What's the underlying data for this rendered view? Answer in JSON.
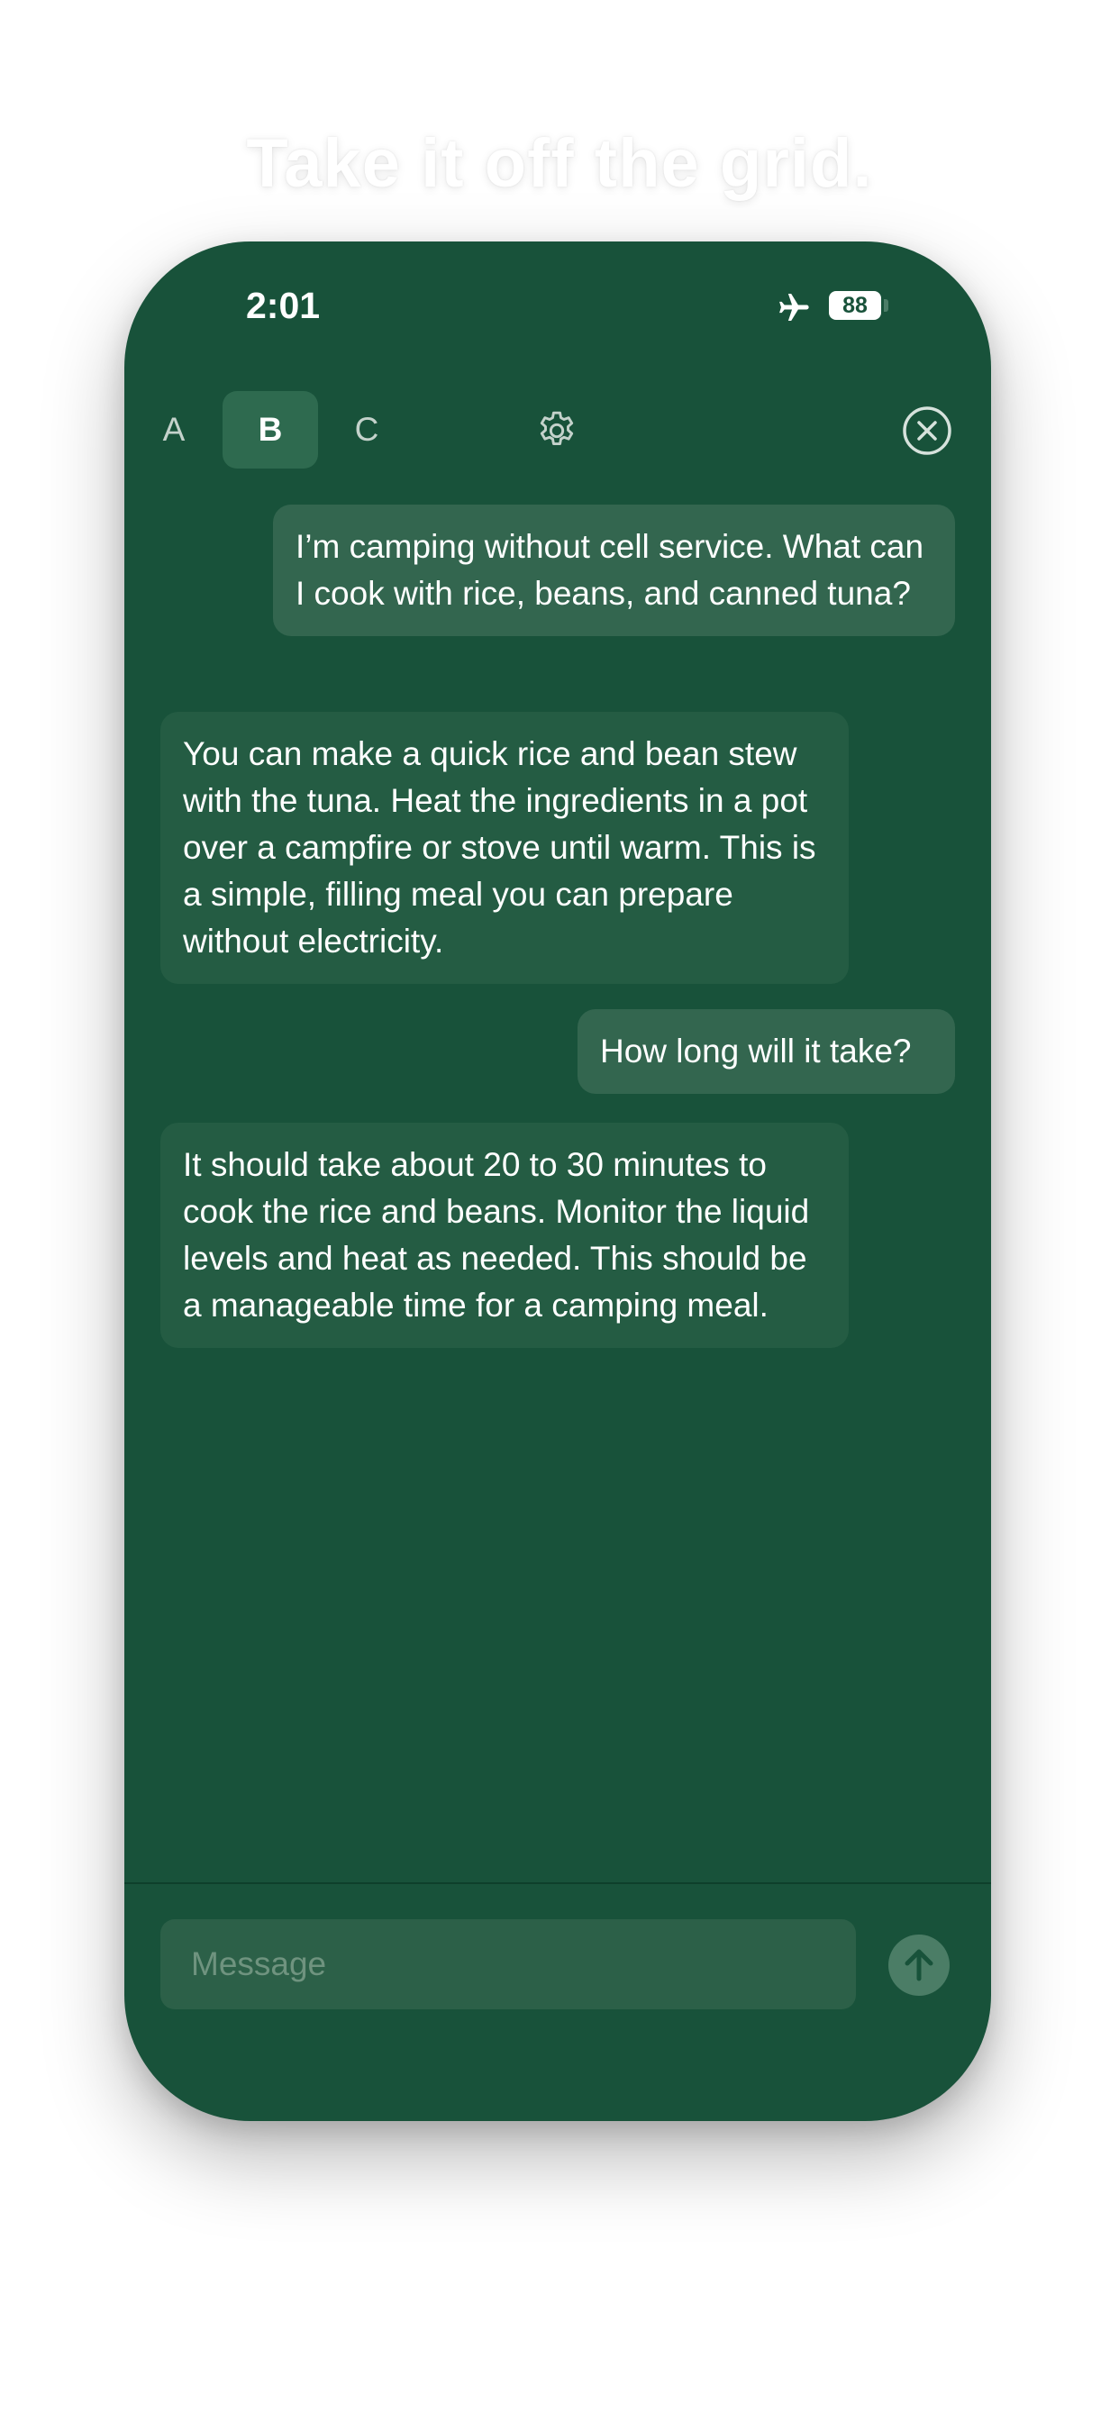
{
  "headline": "Take it off the grid.",
  "status_bar": {
    "time": "2:01",
    "battery": "88",
    "icons": [
      "airplane-icon",
      "battery-icon"
    ]
  },
  "tabs": [
    {
      "label": "A",
      "selected": false
    },
    {
      "label": "B",
      "selected": true
    },
    {
      "label": "C",
      "selected": false
    }
  ],
  "toolbar": {
    "icons": [
      "gear-icon",
      "close-icon"
    ]
  },
  "messages": [
    {
      "role": "user",
      "text": "I’m camping without cell service. What can I cook with rice, beans, and canned tuna?"
    },
    {
      "role": "assistant",
      "text": "You can make a quick rice and bean stew with the tuna. Heat the ingredients in a pot over a campfire or stove until warm. This is a simple, filling meal you can prepare without electricity."
    },
    {
      "role": "user",
      "text": "How long will it take?"
    },
    {
      "role": "assistant",
      "text": "It should take about 20 to 30 minutes to cook the rice and beans. Monitor the liquid levels and heat as needed. This should be a manageable time for a camping meal."
    }
  ],
  "composer": {
    "placeholder": "Message",
    "value": "",
    "send_icon": "arrow-up-icon"
  },
  "colors": {
    "background": "#18523a",
    "user_bubble": "#33664f",
    "assistant_bubble": "#245c43",
    "send_button": "#4b7d66"
  }
}
